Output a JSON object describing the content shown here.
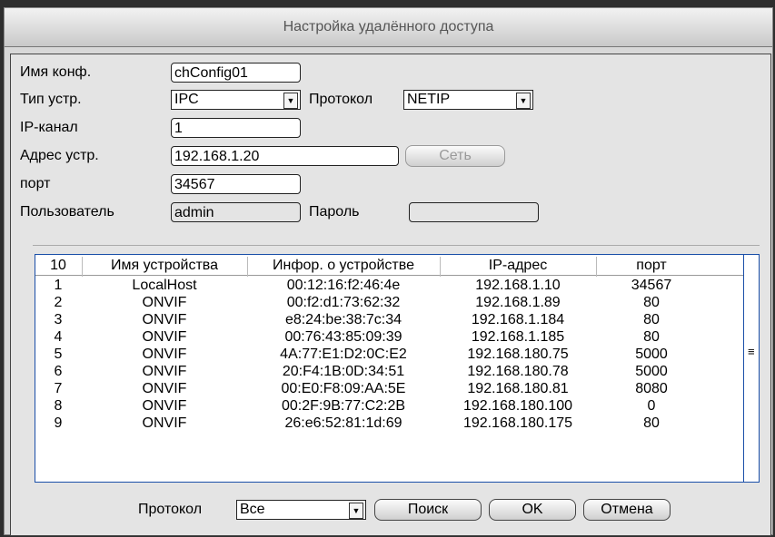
{
  "title": "Настройка удалённого доступа",
  "form": {
    "config_name_label": "Имя конф.",
    "config_name_value": "chConfig01",
    "device_type_label": "Тип устр.",
    "device_type_value": "IPC",
    "protocol_label": "Протокол",
    "protocol_value": "NETIP",
    "ip_channel_label": "IP-канал",
    "ip_channel_value": "1",
    "device_address_label": "Адрес устр.",
    "device_address_value": "192.168.1.20",
    "network_button": "Сеть",
    "port_label": "порт",
    "port_value": "34567",
    "user_label": "Пользователь",
    "user_value": "admin",
    "password_label": "Пароль",
    "password_value": ""
  },
  "table": {
    "count": "10",
    "headers": [
      "Имя устройства",
      "Инфор. о устройстве",
      "IP-адрес",
      "порт"
    ],
    "rows": [
      [
        "1",
        "LocalHost",
        "00:12:16:f2:46:4e",
        "192.168.1.10",
        "34567"
      ],
      [
        "2",
        "ONVIF",
        "00:f2:d1:73:62:32",
        "192.168.1.89",
        "80"
      ],
      [
        "3",
        "ONVIF",
        "e8:24:be:38:7c:34",
        "192.168.1.184",
        "80"
      ],
      [
        "4",
        "ONVIF",
        "00:76:43:85:09:39",
        "192.168.1.185",
        "80"
      ],
      [
        "5",
        "ONVIF",
        "4A:77:E1:D2:0C:E2",
        "192.168.180.75",
        "5000"
      ],
      [
        "6",
        "ONVIF",
        "20:F4:1B:0D:34:51",
        "192.168.180.78",
        "5000"
      ],
      [
        "7",
        "ONVIF",
        "00:E0:F8:09:AA:5E",
        "192.168.180.81",
        "8080"
      ],
      [
        "8",
        "ONVIF",
        "00:2F:9B:77:C2:2B",
        "192.168.180.100",
        "0"
      ],
      [
        "9",
        "ONVIF",
        "26:e6:52:81:1d:69",
        "192.168.180.175",
        "80"
      ]
    ]
  },
  "footer": {
    "protocol_label": "Протокол",
    "protocol_value": "Все",
    "search_button": "Поиск",
    "ok_button": "OK",
    "cancel_button": "Отмена"
  },
  "colors": {
    "accent": "#1a4fa8"
  }
}
